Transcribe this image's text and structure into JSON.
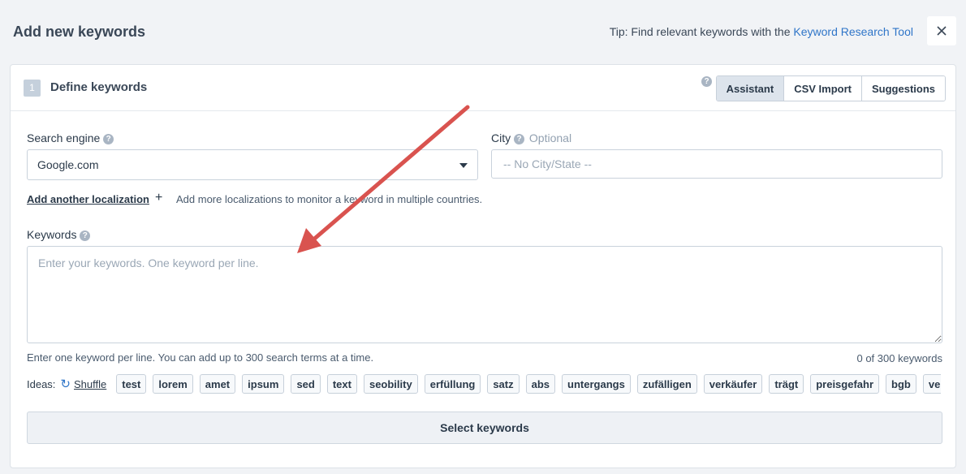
{
  "dialog": {
    "title": "Add new keywords",
    "tip_prefix": "Tip: Find relevant keywords with the ",
    "tip_link": "Keyword Research Tool",
    "close_icon": "close-icon"
  },
  "step": {
    "number": "1",
    "title": "Define keywords",
    "tabs": [
      {
        "label": "Assistant",
        "active": true
      },
      {
        "label": "CSV Import",
        "active": false
      },
      {
        "label": "Suggestions",
        "active": false
      }
    ]
  },
  "search_engine": {
    "label": "Search engine",
    "value": "Google.com"
  },
  "city": {
    "label": "City",
    "optional": "Optional",
    "placeholder": "-- No City/State --"
  },
  "localization": {
    "link": "Add another localization",
    "plus": "+",
    "hint": "Add more localizations to monitor a keyword in multiple countries."
  },
  "keywords": {
    "label": "Keywords",
    "placeholder": "Enter your keywords. One keyword per line.",
    "hint": "Enter one keyword per line. You can add up to 300 search terms at a time.",
    "count": "0 of 300 keywords"
  },
  "ideas": {
    "label": "Ideas:",
    "shuffle": "Shuffle",
    "chips": [
      "test",
      "lorem",
      "amet",
      "ipsum",
      "sed",
      "text",
      "seobility",
      "erfüllung",
      "satz",
      "abs",
      "untergangs",
      "zufälligen",
      "verkäufer",
      "trägt",
      "preisgefahr",
      "bgb",
      "verbraucher"
    ]
  },
  "select_button": "Select keywords",
  "colors": {
    "link": "#2f75c8",
    "annotation_arrow": "#d9534f"
  }
}
